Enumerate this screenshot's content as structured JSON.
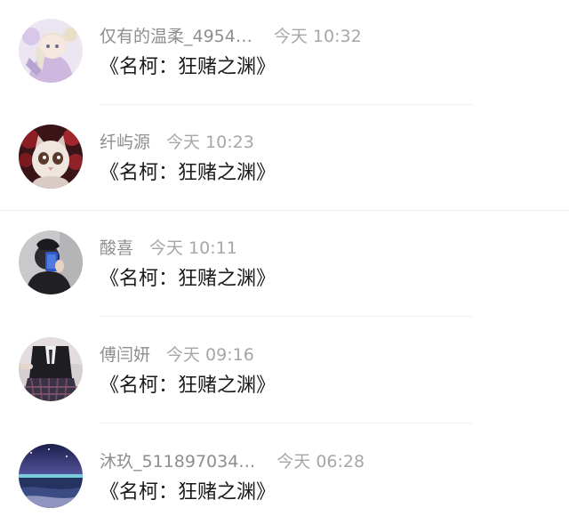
{
  "comments": [
    {
      "name": "仅有的温柔_4954…",
      "time": "今天 10:32",
      "content": "《名柯：狂赌之渊》",
      "avatar": "anime-girl-avatar"
    },
    {
      "name": "纤屿源",
      "time": "今天 10:23",
      "content": "《名柯：狂赌之渊》",
      "avatar": "cat-with-roses-avatar"
    },
    {
      "name": "酸喜",
      "time": "今天 10:11",
      "content": "《名柯：狂赌之渊》",
      "avatar": "mirror-selfie-avatar"
    },
    {
      "name": "傅闫妍",
      "time": "今天 09:16",
      "content": "《名柯：狂赌之渊》",
      "avatar": "uniform-girl-avatar"
    },
    {
      "name": "沐玖_511897034…",
      "time": "今天 06:28",
      "content": "《名柯：狂赌之渊》",
      "avatar": "night-sea-avatar"
    }
  ]
}
